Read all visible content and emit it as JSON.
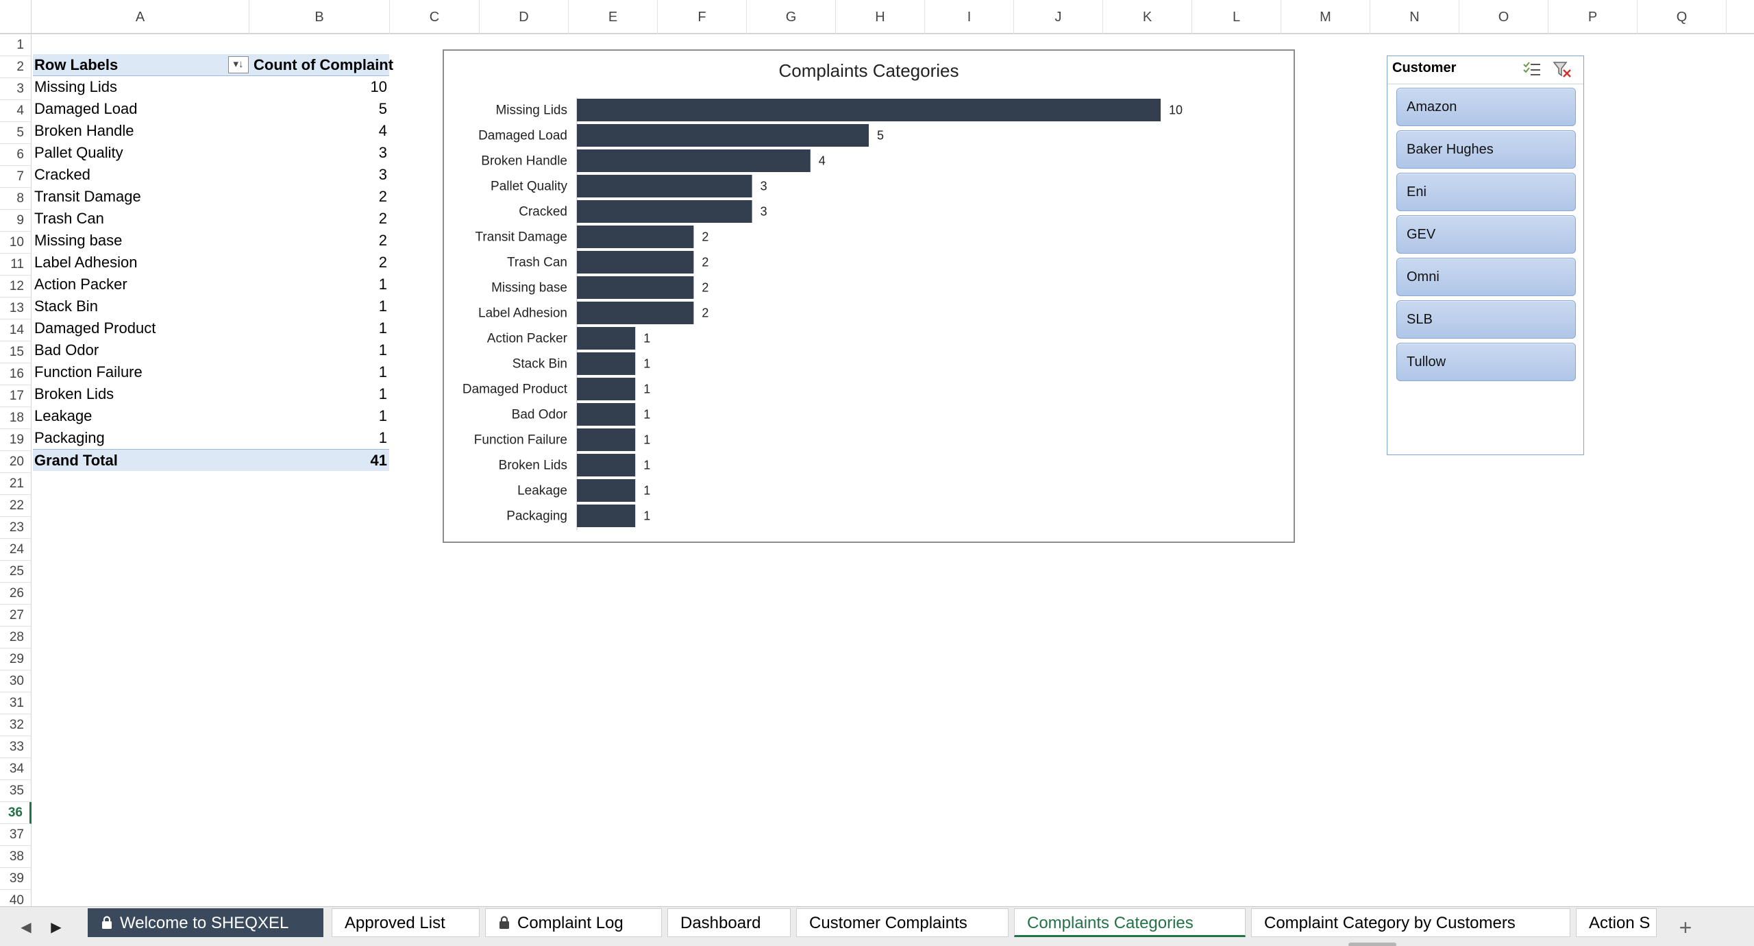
{
  "columns": [
    "A",
    "B",
    "C",
    "D",
    "E",
    "F",
    "G",
    "H",
    "I",
    "J",
    "K",
    "L",
    "M",
    "N",
    "O",
    "P",
    "Q"
  ],
  "rows": [
    "1",
    "2",
    "3",
    "4",
    "5",
    "6",
    "7",
    "8",
    "9",
    "10",
    "11",
    "12",
    "13",
    "14",
    "15",
    "16",
    "17",
    "18",
    "19",
    "20",
    "21",
    "22",
    "23",
    "24",
    "25",
    "26",
    "27",
    "28",
    "29",
    "30",
    "31",
    "32",
    "33",
    "34",
    "35",
    "36",
    "37",
    "38",
    "39",
    "40"
  ],
  "selected_row": "36",
  "pivot": {
    "header_label": "Row Labels",
    "header_value": "Count of Complaint",
    "filter_icon": "sort-filter-icon",
    "items": [
      {
        "label": "Missing Lids",
        "value": 10
      },
      {
        "label": "Damaged Load",
        "value": 5
      },
      {
        "label": "Broken Handle",
        "value": 4
      },
      {
        "label": "Pallet Quality",
        "value": 3
      },
      {
        "label": "Cracked",
        "value": 3
      },
      {
        "label": "Transit Damage",
        "value": 2
      },
      {
        "label": "Trash Can",
        "value": 2
      },
      {
        "label": "Missing base",
        "value": 2
      },
      {
        "label": "Label Adhesion",
        "value": 2
      },
      {
        "label": "Action Packer",
        "value": 1
      },
      {
        "label": "Stack Bin",
        "value": 1
      },
      {
        "label": "Damaged Product",
        "value": 1
      },
      {
        "label": "Bad Odor",
        "value": 1
      },
      {
        "label": "Function Failure",
        "value": 1
      },
      {
        "label": "Broken Lids",
        "value": 1
      },
      {
        "label": "Leakage",
        "value": 1
      },
      {
        "label": "Packaging",
        "value": 1
      }
    ],
    "total_label": "Grand Total",
    "total_value": 41
  },
  "chart_data": {
    "type": "bar",
    "orientation": "horizontal",
    "title": "Complaints  Categories",
    "categories": [
      "Missing Lids",
      "Damaged Load",
      "Broken Handle",
      "Pallet Quality",
      "Cracked",
      "Transit Damage",
      "Trash Can",
      "Missing base",
      "Label Adhesion",
      "Action Packer",
      "Stack Bin",
      "Damaged Product",
      "Bad Odor",
      "Function Failure",
      "Broken Lids",
      "Leakage",
      "Packaging"
    ],
    "values": [
      10,
      5,
      4,
      3,
      3,
      2,
      2,
      2,
      2,
      1,
      1,
      1,
      1,
      1,
      1,
      1,
      1
    ],
    "bar_color": "#333e4f",
    "xlim": [
      0,
      10
    ],
    "grid": false,
    "data_labels": true,
    "legend": "none"
  },
  "slicer": {
    "title": "Customer",
    "multi_select_icon": "multi-select-icon",
    "clear_filter_icon": "clear-filter-icon",
    "items": [
      "Amazon",
      "Baker Hughes",
      "Eni",
      "GEV",
      "Omni",
      "SLB",
      "Tullow"
    ]
  },
  "tabs": {
    "prev_icon": "chevron-left-icon",
    "next_icon": "chevron-right-icon",
    "items": [
      {
        "label": "Welcome to SHEQXEL",
        "locked": true,
        "style": "dark"
      },
      {
        "label": "Approved List",
        "locked": false,
        "style": "normal"
      },
      {
        "label": "Complaint Log",
        "locked": true,
        "style": "normal"
      },
      {
        "label": "Dashboard",
        "locked": false,
        "style": "normal"
      },
      {
        "label": "Customer Complaints",
        "locked": false,
        "style": "normal"
      },
      {
        "label": "Complaints Categories",
        "locked": false,
        "style": "active"
      },
      {
        "label": "Complaint Category by Customers",
        "locked": false,
        "style": "normal"
      },
      {
        "label": "Action S",
        "locked": false,
        "style": "normal"
      }
    ],
    "add_label": "+",
    "active_color": "#217346"
  }
}
